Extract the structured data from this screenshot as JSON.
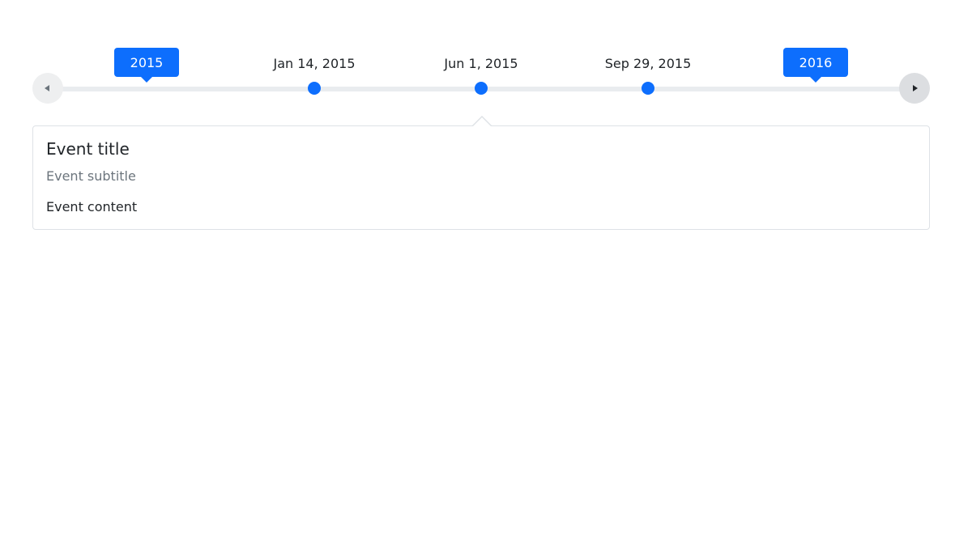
{
  "timeline": {
    "prev_button": {
      "icon": "caret-left-icon"
    },
    "next_button": {
      "icon": "caret-right-icon"
    },
    "years": [
      {
        "label": "2015"
      },
      {
        "label": "2016"
      }
    ],
    "events": [
      {
        "date": "Jan 14, 2015"
      },
      {
        "date": "Jun 1, 2015"
      },
      {
        "date": "Sep 29, 2015"
      }
    ]
  },
  "event_card": {
    "title": "Event title",
    "subtitle": "Event subtitle",
    "content": "Event content"
  },
  "colors": {
    "accent": "#0d6efd",
    "track": "#e9ecef",
    "border": "#dee2e6",
    "muted_text": "#6c757d",
    "text": "#212529"
  }
}
